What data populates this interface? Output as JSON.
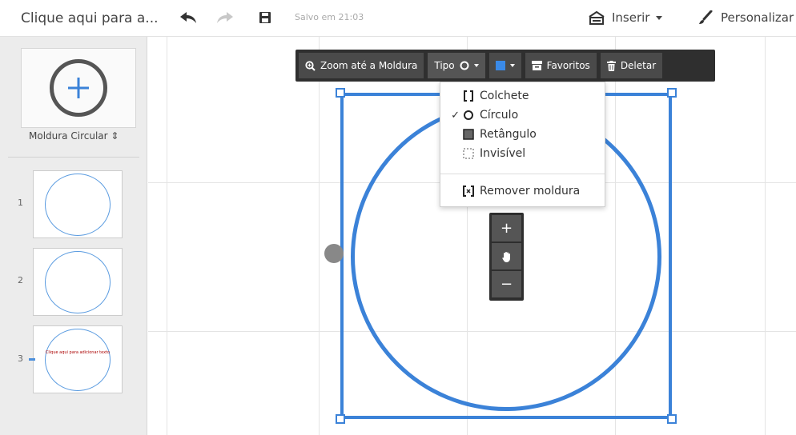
{
  "header": {
    "title": "Clique aqui para a...",
    "saved_status": "Salvo em 21:03",
    "insert_label": "Inserir",
    "customize_label": "Personalizar",
    "icons": [
      "undo-icon",
      "redo-icon",
      "save-icon",
      "insert-icon",
      "brush-icon"
    ]
  },
  "sidebar": {
    "frame_type_label": "Moldura Circular ⇕",
    "slides": [
      {
        "number": "1"
      },
      {
        "number": "2"
      },
      {
        "number": "3",
        "text": "Clique aqui para adicionar texto"
      }
    ]
  },
  "frame_toolbar": {
    "zoom_label": "Zoom até a Moldura",
    "type_label": "Tipo",
    "favorites_label": "Favoritos",
    "delete_label": "Deletar"
  },
  "type_menu": {
    "items": [
      {
        "label": "Colchete",
        "checked": false
      },
      {
        "label": "Círculo",
        "checked": true
      },
      {
        "label": "Retângulo",
        "checked": false
      },
      {
        "label": "Invisível",
        "checked": false
      }
    ],
    "remove_label": "Remover moldura",
    "check_mark": "✓"
  },
  "zoom": {
    "in": "+",
    "out": "−"
  },
  "colors": {
    "accent": "#3b82d8",
    "toolbar": "#2f2f2f",
    "swatch": "#3a8ae8"
  }
}
